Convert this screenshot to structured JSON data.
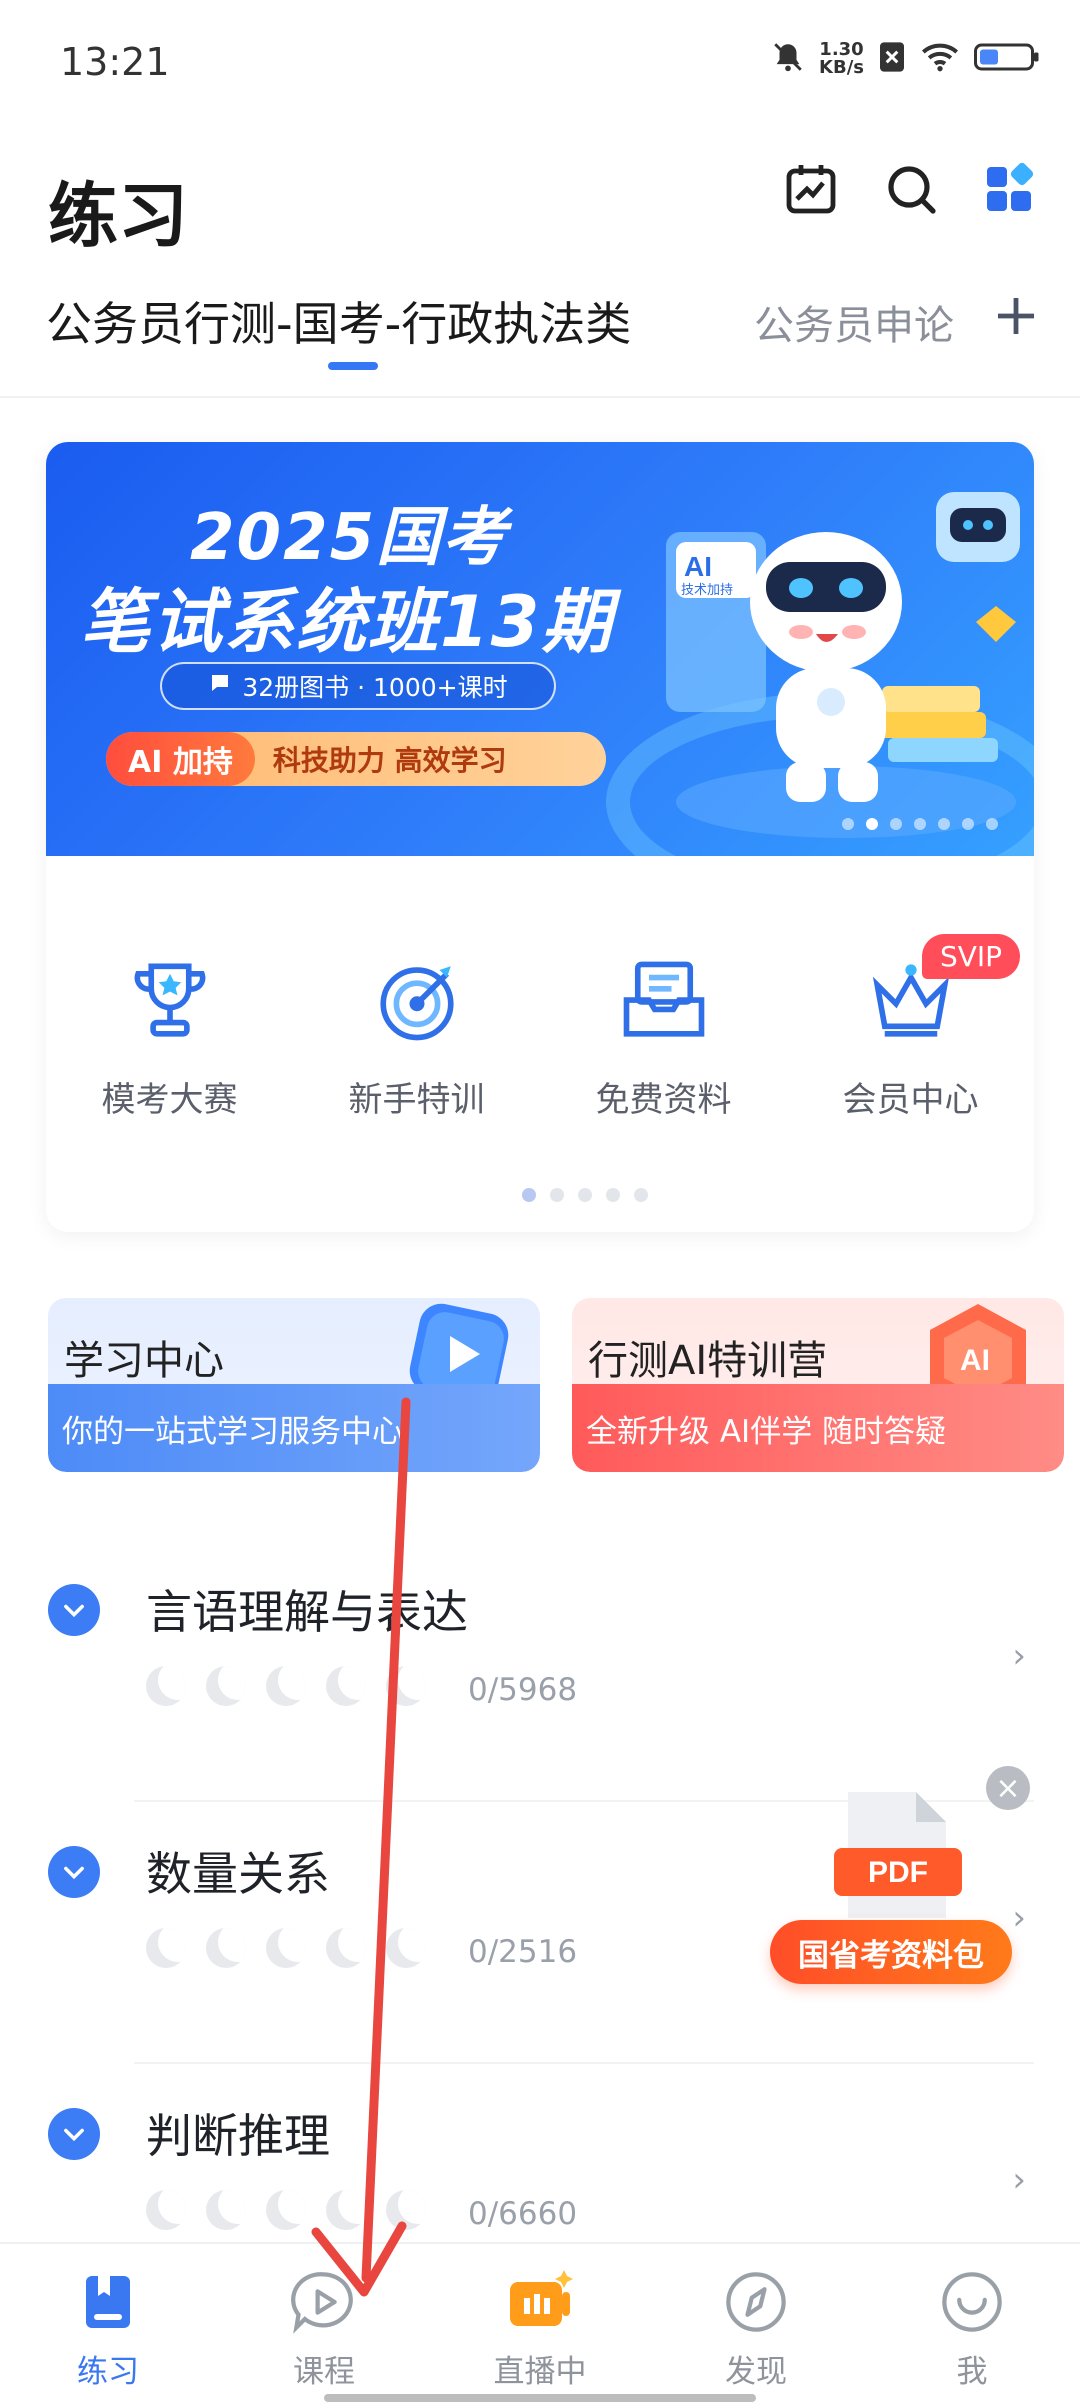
{
  "status_bar": {
    "time": "13:21",
    "net_speed_value": "1.30",
    "net_speed_unit": "KB/s"
  },
  "header": {
    "title": "练习",
    "icons": [
      "calendar-chart-icon",
      "search-icon",
      "apps-grid-icon"
    ]
  },
  "tabs": {
    "active": "公务员行测-国考-行政执法类",
    "other": "公务员申论"
  },
  "banner": {
    "title_line1": "2025国考",
    "title_line2": "笔试系统班13期",
    "pill_text": "32册图书 · 1000+课时",
    "ai_tag": "AI 加持",
    "ai_text": "科技助力 高效学习",
    "robot_badge": "AI",
    "robot_badge_sub": "技术加持"
  },
  "quick_entries": [
    {
      "label": "模考大赛",
      "icon": "trophy-icon"
    },
    {
      "label": "新手特训",
      "icon": "target-icon"
    },
    {
      "label": "免费资料",
      "icon": "file-box-icon"
    },
    {
      "label": "会员中心",
      "icon": "crown-icon"
    }
  ],
  "svip_badge": "SVIP",
  "features": {
    "study_center": {
      "title": "学习中心",
      "subtitle": "你的一站式学习服务中心"
    },
    "ai_camp": {
      "title": "行测AI特训营",
      "subtitle": "全新升级 AI伴学 随时答疑"
    }
  },
  "subjects": [
    {
      "name": "言语理解与表达",
      "count": "0/5968"
    },
    {
      "name": "数量关系",
      "count": "0/2516"
    },
    {
      "name": "判断推理",
      "count": "0/6660"
    }
  ],
  "pdf_promo": {
    "file_label": "PDF",
    "button": "国省考资料包"
  },
  "bottom_nav": [
    {
      "label": "练习",
      "icon": "book-icon"
    },
    {
      "label": "课程",
      "icon": "play-bubble-icon"
    },
    {
      "label": "直播中",
      "icon": "live-icon"
    },
    {
      "label": "发现",
      "icon": "compass-icon"
    },
    {
      "label": "我",
      "icon": "smile-icon"
    }
  ],
  "colors": {
    "accent": "#3a78f2",
    "annotation_arrow": "#e8463f",
    "svip": "#ff4d5a",
    "pdf_button": "#ff5a28"
  }
}
